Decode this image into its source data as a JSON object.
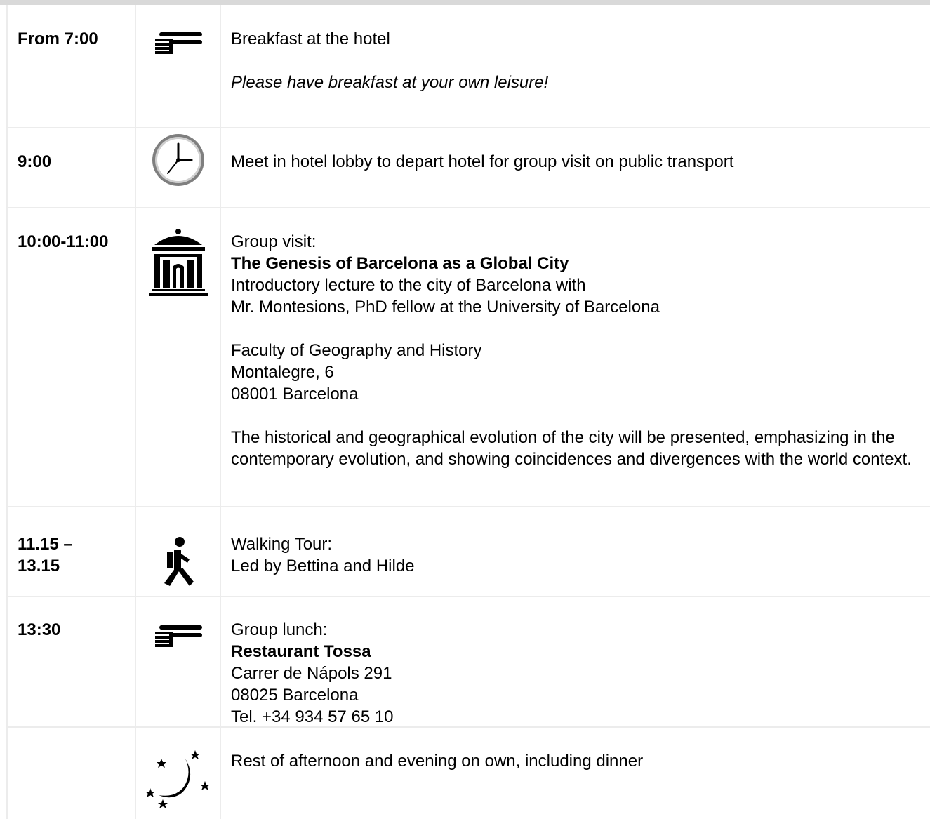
{
  "schedule": [
    {
      "time": "From 7:00",
      "icon": "cutlery-icon",
      "title": "Breakfast at the hotel",
      "note": "Please have breakfast at your own leisure!"
    },
    {
      "time": "9:00",
      "icon": "clock-icon",
      "title": "Meet in hotel lobby to depart hotel for group visit on public transport"
    },
    {
      "time": "10:00-11:00",
      "icon": "museum-icon",
      "intro": "Group visit:",
      "heading": "The Genesis of Barcelona as a Global City",
      "lines": [
        "Introductory lecture to the city of Barcelona with",
        "Mr. Montesions, PhD fellow at the University of Barcelona"
      ],
      "address": [
        "Faculty of Geography and History",
        "Montalegre, 6",
        "08001 Barcelona"
      ],
      "summary": "The historical and geographical evolution of the city will be presented, emphasizing in the contemporary evolution, and showing coincidences and divergences with the world context."
    },
    {
      "time_line1": "11.15 –",
      "time_line2": "13.15",
      "icon": "walking-person-icon",
      "intro": "Walking Tour:",
      "detail": "Led by Bettina and Hilde"
    },
    {
      "time": "13:30",
      "icon": "cutlery-icon",
      "intro": "Group lunch:",
      "heading": "Restaurant Tossa",
      "address": [
        "Carrer de Nápols 291",
        "08025 Barcelona",
        "Tel. +34 934 57 65 10"
      ]
    },
    {
      "time": "",
      "icon": "moon-stars-icon",
      "title": "Rest of afternoon and evening on own, including dinner"
    }
  ],
  "colors": {
    "grid_line": "#ececec",
    "top_bar": "#d9d9d9",
    "text": "#000000",
    "clock_face": "#8a8a8a"
  }
}
